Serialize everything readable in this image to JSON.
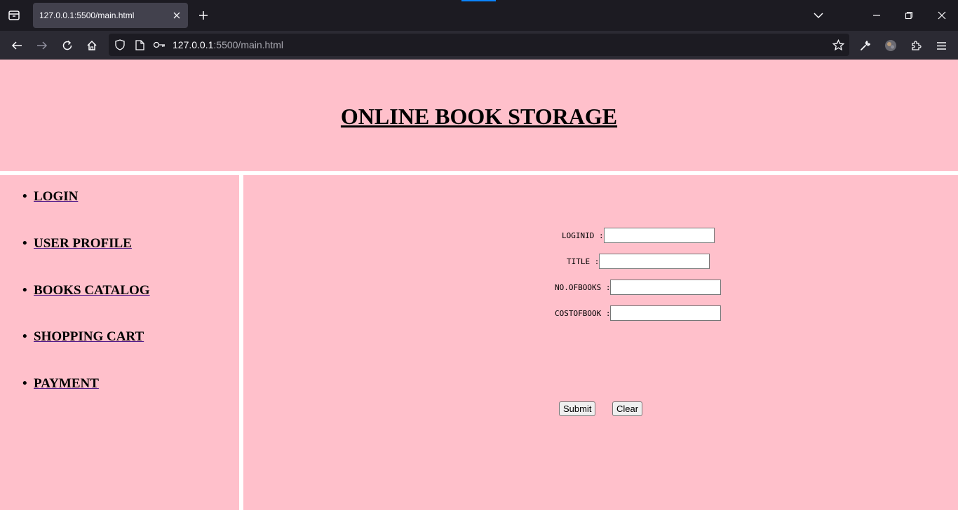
{
  "browser": {
    "tab_title": "127.0.0.1:5500/main.html",
    "url_host": "127.0.0.1",
    "url_rest": ":5500/main.html",
    "colors": {
      "chrome_dark": "#1c1b22",
      "toolbar": "#2b2a33",
      "active_tab": "#42414d",
      "accent": "#0a84ff"
    }
  },
  "page": {
    "title": "ONLINE BOOK STORAGE",
    "background": "#ffc0cb",
    "nav": [
      {
        "bullet": "•",
        "label": "LOGIN"
      },
      {
        "bullet": "•",
        "label": "USER PROFILE"
      },
      {
        "bullet": "•",
        "label": "BOOKS CATALOG"
      },
      {
        "bullet": "•",
        "label": "SHOPPING CART"
      },
      {
        "bullet": "•",
        "label": "PAYMENT"
      }
    ],
    "form": {
      "fields": [
        {
          "label": "LOGINID :",
          "value": ""
        },
        {
          "label": "TITLE :",
          "value": ""
        },
        {
          "label": "NO.OFBOOKS :",
          "value": ""
        },
        {
          "label": "COSTOFBOOK :",
          "value": ""
        }
      ],
      "submit_label": "Submit",
      "clear_label": "Clear"
    }
  }
}
